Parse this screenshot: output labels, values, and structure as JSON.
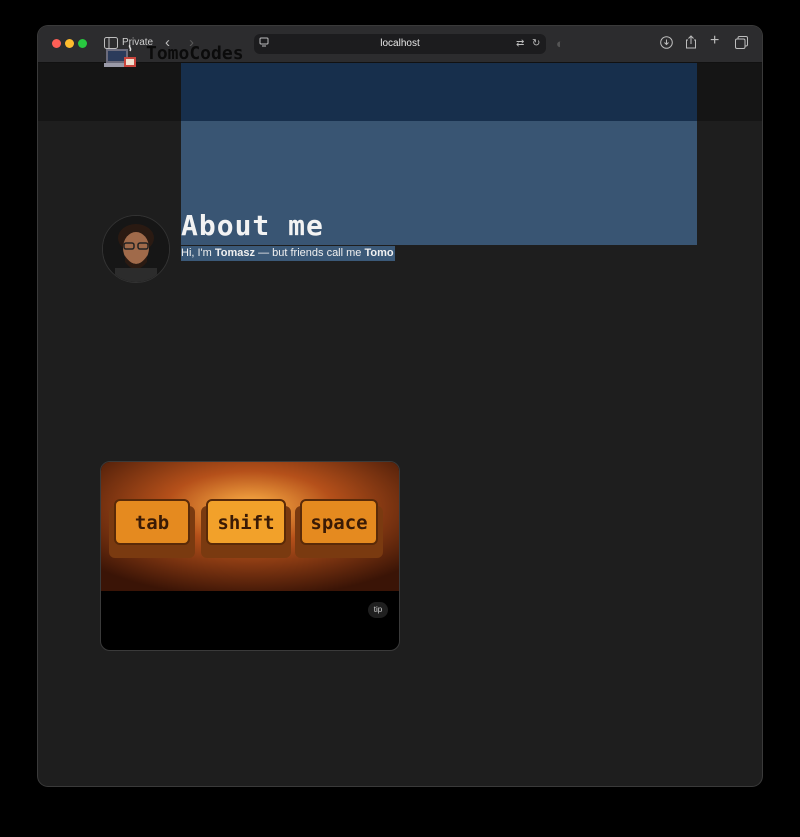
{
  "browser": {
    "mode_label": "Private",
    "url": "localhost"
  },
  "site": {
    "brand": "TomoCodes"
  },
  "about": {
    "title": "About me",
    "intro_prefix": "Hi, I'm ",
    "intro_name": "Tomasz",
    "intro_middle": " — but friends call me ",
    "intro_nickname": "Tomo"
  },
  "card": {
    "keys": [
      "tab",
      "shift",
      "space"
    ],
    "badge": "tip"
  },
  "colors": {
    "accent_selection": "#3b5978",
    "key_orange": "#e58a1f"
  }
}
